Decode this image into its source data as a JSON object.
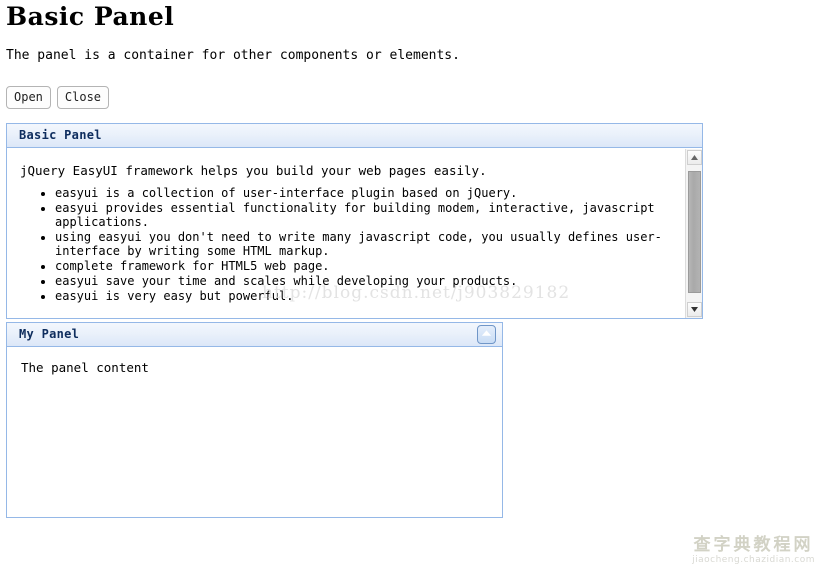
{
  "page": {
    "title": "Basic Panel",
    "intro": "The panel is a container for other components or elements."
  },
  "toolbar": {
    "open_label": "Open",
    "close_label": "Close"
  },
  "panels": [
    {
      "title": "Basic Panel",
      "paragraph": "jQuery EasyUI framework helps you build your web pages easily.",
      "bullets": [
        "easyui is a collection of user-interface plugin based on jQuery.",
        "easyui provides essential functionality for building modem, interactive, javascript applications.",
        "using easyui you don't need to write many javascript code, you usually defines user-interface by writing some HTML markup.",
        "complete framework for HTML5 web page.",
        "easyui save your time and scales while developing your products.",
        "easyui is very easy but powerful."
      ],
      "scrollbar": {
        "up_icon": "triangle-up-icon",
        "down_icon": "triangle-down-icon"
      }
    },
    {
      "title": "My Panel",
      "content": "The panel content",
      "tool_icon": "collapse-up-icon"
    }
  ],
  "watermarks": {
    "url": "http://blog.csdn.net/j903829182",
    "logo_cn": "查字典教程网",
    "logo_en": "jiaocheng.chazidian.com"
  },
  "colors": {
    "panel_border": "#95b8e7",
    "header_text": "#0e2d5e",
    "header_gradient_top": "#f3f7fd",
    "header_gradient_bottom": "#dce7f8"
  }
}
